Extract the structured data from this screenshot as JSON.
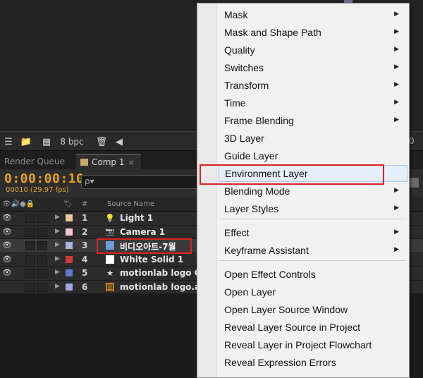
{
  "toolbar": {
    "bpc": "8 bpc",
    "right_value": "0"
  },
  "tabs": {
    "render_queue": "Render Queue",
    "comp": "Comp 1",
    "comp_close": "×"
  },
  "timeline": {
    "timecode": "0:00:00:10",
    "frames": "00010 (29.97 fps)",
    "search_glyph": "ρ▾"
  },
  "columns": {
    "number": "#",
    "source_name": "Source Name"
  },
  "layers": [
    {
      "num": "1",
      "name": "Light 1",
      "label_color": "#f0c8a0",
      "icon": "lightbulb-icon",
      "glyph": "💡"
    },
    {
      "num": "2",
      "name": "Camera 1",
      "label_color": "#f0c8d8",
      "icon": "camera-icon",
      "glyph": "📷"
    },
    {
      "num": "3",
      "name": "비디오아트-7월",
      "label_color": "#a8b8e0",
      "icon": "footage-icon",
      "glyph": "▣"
    },
    {
      "num": "4",
      "name": "White Solid 1",
      "label_color": "#c83a3a",
      "icon": "solid-icon",
      "glyph": "■"
    },
    {
      "num": "5",
      "name": "motionlab logo O",
      "label_color": "#5a7acc",
      "icon": "star-icon",
      "glyph": "★"
    },
    {
      "num": "6",
      "name": "motionlab logo.a",
      "label_color": "#a0a8e0",
      "icon": "composition-icon",
      "glyph": "▤"
    }
  ],
  "menu": {
    "items": [
      {
        "label": "Mask",
        "submenu": true
      },
      {
        "label": "Mask and Shape Path",
        "submenu": true
      },
      {
        "label": "Quality",
        "submenu": true
      },
      {
        "label": "Switches",
        "submenu": true
      },
      {
        "label": "Transform",
        "submenu": true
      },
      {
        "label": "Time",
        "submenu": true
      },
      {
        "label": "Frame Blending",
        "submenu": true
      },
      {
        "label": "3D Layer",
        "submenu": false
      },
      {
        "label": "Guide Layer",
        "submenu": false
      },
      {
        "label": "Environment Layer",
        "submenu": false
      },
      {
        "label": "Blending Mode",
        "submenu": true
      },
      {
        "label": "Layer Styles",
        "submenu": true
      },
      {
        "label": "Effect",
        "submenu": true
      },
      {
        "label": "Keyframe Assistant",
        "submenu": true
      },
      {
        "label": "Open Effect Controls",
        "submenu": false
      },
      {
        "label": "Open Layer",
        "submenu": false
      },
      {
        "label": "Open Layer Source Window",
        "submenu": false
      },
      {
        "label": "Reveal Layer Source in Project",
        "submenu": false
      },
      {
        "label": "Reveal Layer in Project Flowchart",
        "submenu": false
      },
      {
        "label": "Reveal Expression Errors",
        "submenu": false
      }
    ],
    "arrow": "▶"
  }
}
